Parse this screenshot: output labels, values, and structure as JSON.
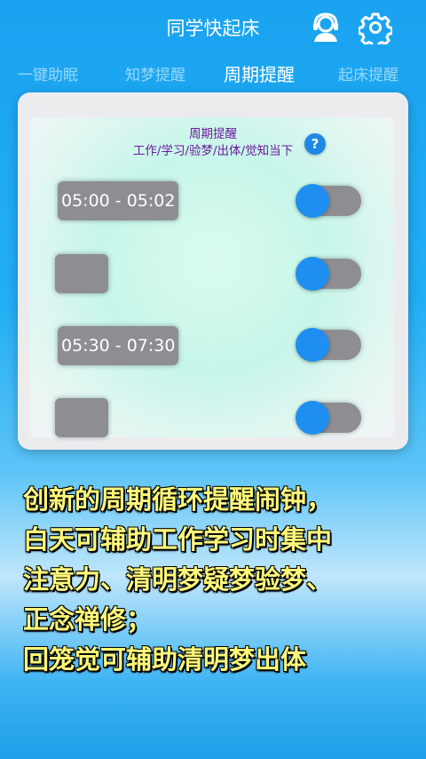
{
  "app": {
    "title": "同学快起床"
  },
  "header_icons": {
    "support": "headset-user-icon",
    "settings": "gear-icon"
  },
  "tabs": [
    {
      "label": "一键助眠",
      "active": false
    },
    {
      "label": "知梦提醒",
      "active": false
    },
    {
      "label": "周期提醒",
      "active": true
    },
    {
      "label": "起床提醒",
      "active": false
    }
  ],
  "panel": {
    "title": "周期提醒",
    "subtitle": "工作/学习/验梦/出体/觉知当下",
    "help_label": "?",
    "rows": [
      {
        "time": "05:00 - 05:02",
        "toggle": "off"
      },
      {
        "time": "",
        "toggle": "off"
      },
      {
        "time": "05:30 - 07:30",
        "toggle": "off"
      },
      {
        "time": "",
        "toggle": "off"
      }
    ]
  },
  "promo": {
    "lines": [
      "创新的周期循环提醒闹钟，",
      "白天可辅助工作学习时集中",
      "注意力、清明梦疑梦验梦、",
      "正念禅修；",
      "回笼觉可辅助清明梦出体"
    ]
  },
  "colors": {
    "accent": "#1e8ff0",
    "panel_title": "#6a1b9a",
    "promo_text": "#fff87a"
  }
}
